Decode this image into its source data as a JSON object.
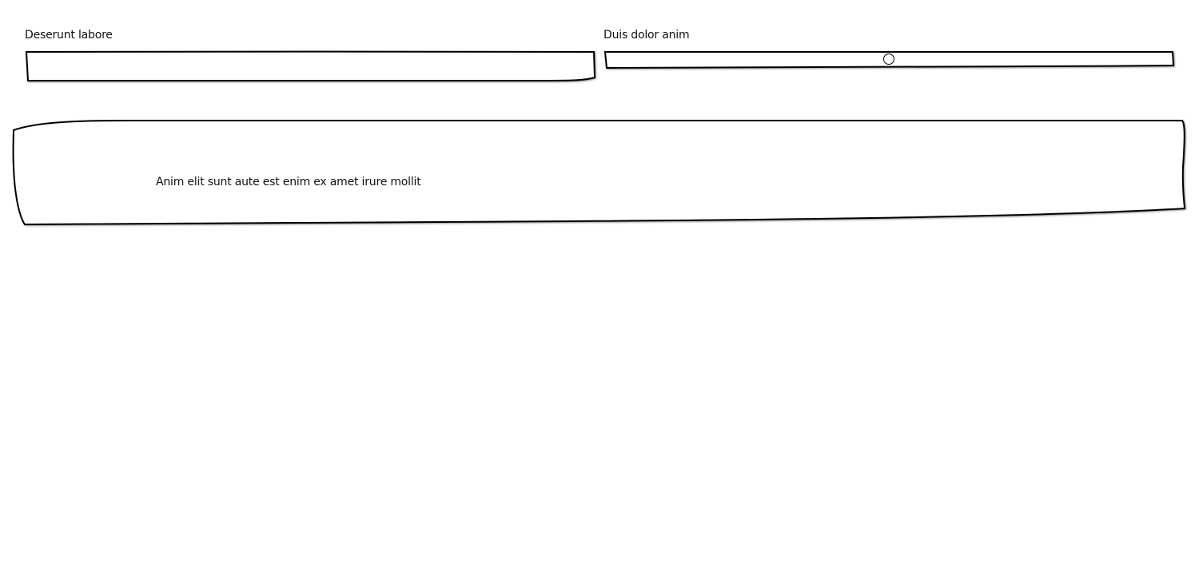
{
  "text_field": {
    "label": "Deserunt labore",
    "value": ""
  },
  "slider": {
    "label": "Duis dolor anim",
    "min": 0,
    "max": 100,
    "value": 50
  },
  "card": {
    "text": "Anim elit sunt aute est enim ex amet irure mollit"
  }
}
